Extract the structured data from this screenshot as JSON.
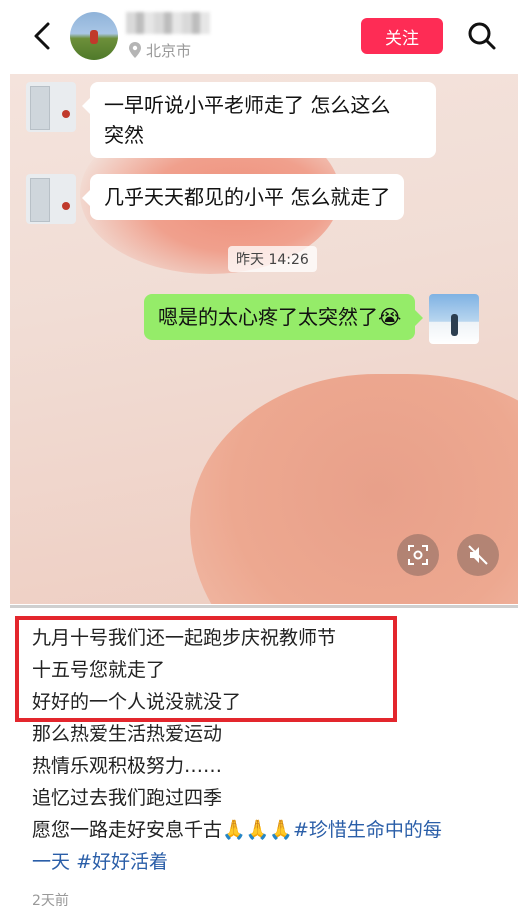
{
  "header": {
    "location": "北京市",
    "follow_label": "关注"
  },
  "chat": {
    "messages_left": [
      "一早听说小平老师走了 怎么这么",
      "突然",
      "几乎天天都见的小平 怎么就走了"
    ],
    "timestamp": "昨天 14:26",
    "message_right": "嗯是的太心疼了太突然了😭"
  },
  "caption": {
    "lines": [
      "九月十号我们还一起跑步庆祝教师节",
      "十五号您就走了",
      "好好的一个人说没就没了",
      "那么热爱生活热爱运动",
      "热情乐观积极努力……",
      "追忆过去我们跑过四季"
    ],
    "last_prefix": "愿您一路走好安息千古🙏🙏🙏",
    "tag1a": "#珍惜生命中的每",
    "tag1b": "一天",
    "tag2": "#好好活着"
  },
  "meta": {
    "posted": "2天前"
  },
  "colors": {
    "follow_bg": "#fe2c55",
    "right_bubble": "#95ec69",
    "tag": "#2a5ea8",
    "highlight_box": "#e3262d"
  }
}
